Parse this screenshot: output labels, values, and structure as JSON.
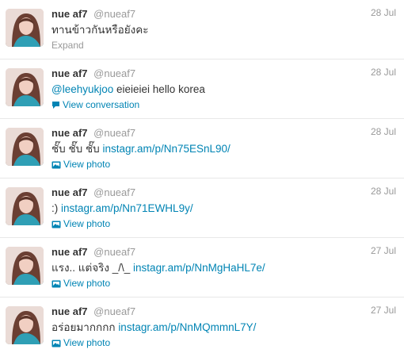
{
  "tweets": [
    {
      "name": "nue af7",
      "handle": "@nueaf7",
      "time": "28 Jul",
      "text_pre": "ทานข้าวกันหรือยังคะ",
      "link": "",
      "text_post": "",
      "action": {
        "label": "Expand",
        "icon": "none",
        "style": "expand"
      }
    },
    {
      "name": "nue af7",
      "handle": "@nueaf7",
      "time": "28 Jul",
      "text_pre": "",
      "link": "@leehyukjoo",
      "text_post": " eieieiei hello korea",
      "action": {
        "label": "View conversation",
        "icon": "speech-bubble-icon",
        "style": "blue"
      }
    },
    {
      "name": "nue af7",
      "handle": "@nueaf7",
      "time": "28 Jul",
      "text_pre": "ชั๊บ ชั๊บ ชั๊บ ",
      "link": "instagr.am/p/Nn75ESnL90/",
      "text_post": "",
      "action": {
        "label": "View photo",
        "icon": "photo-icon",
        "style": "blue"
      }
    },
    {
      "name": "nue af7",
      "handle": "@nueaf7",
      "time": "28 Jul",
      "text_pre": ":) ",
      "link": "instagr.am/p/Nn71EWHL9y/",
      "text_post": "",
      "action": {
        "label": "View photo",
        "icon": "photo-icon",
        "style": "blue"
      }
    },
    {
      "name": "nue af7",
      "handle": "@nueaf7",
      "time": "27 Jul",
      "text_pre": "แรง.. แต่จริง _/\\_ ",
      "link": "instagr.am/p/NnMgHaHL7e/",
      "text_post": "",
      "action": {
        "label": "View photo",
        "icon": "photo-icon",
        "style": "blue"
      }
    },
    {
      "name": "nue af7",
      "handle": "@nueaf7",
      "time": "27 Jul",
      "text_pre": "อร่อยมากกกก ",
      "link": "instagr.am/p/NnMQmmnL7Y/",
      "text_post": "",
      "action": {
        "label": "View photo",
        "icon": "photo-icon",
        "style": "blue"
      }
    }
  ],
  "colors": {
    "link": "#0084b4",
    "muted": "#999999",
    "text": "#333333",
    "divider": "#e8e8e8"
  }
}
